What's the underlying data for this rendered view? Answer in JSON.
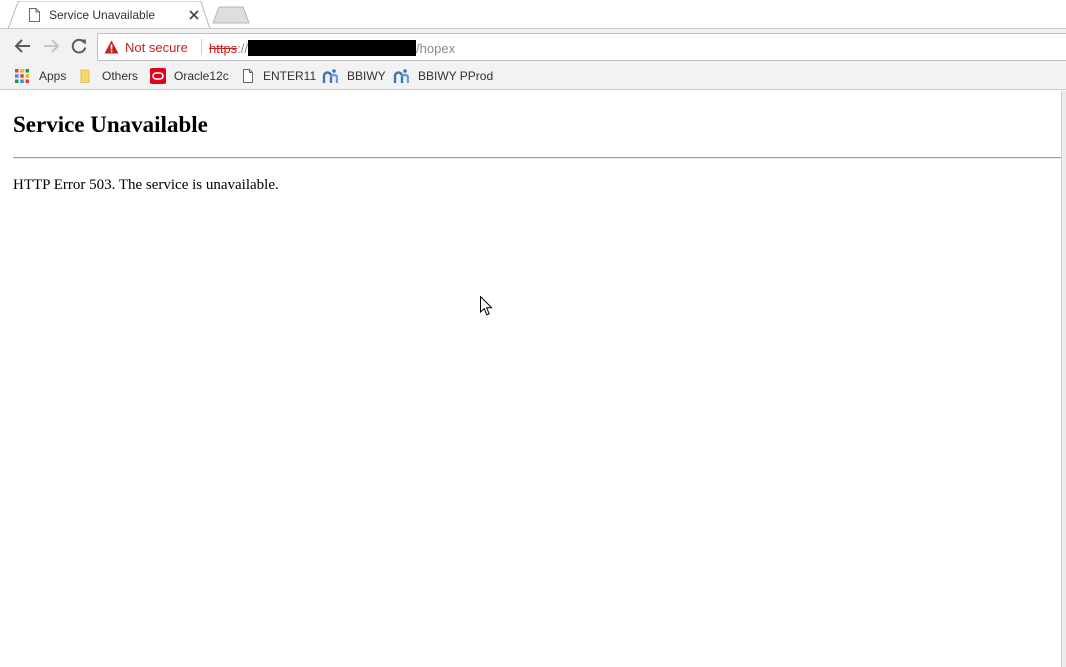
{
  "tab": {
    "title": "Service Unavailable",
    "favicon": "page-icon",
    "close": "close-icon"
  },
  "toolbar": {
    "back": "back-arrow-icon",
    "forward": "forward-arrow-icon",
    "reload": "reload-icon",
    "security_label": "Not secure",
    "security_icon": "warning-triangle-icon",
    "url_scheme": "https",
    "url_separator": "://",
    "url_path": "/hopex"
  },
  "bookmarks": [
    {
      "label": "Apps",
      "icon": "apps-grid-icon"
    },
    {
      "label": "Others",
      "icon": "folder-icon"
    },
    {
      "label": "Oracle12c",
      "icon": "oracle-icon"
    },
    {
      "label": "ENTER11",
      "icon": "page-icon"
    },
    {
      "label": "BBIWY",
      "icon": "app-logo-icon"
    },
    {
      "label": "BBIWY PProd",
      "icon": "app-logo-icon"
    }
  ],
  "page": {
    "heading": "Service Unavailable",
    "message": "HTTP Error 503. The service is unavailable."
  },
  "colors": {
    "warning": "#c5221f",
    "oracle": "#e2001a",
    "folder": "#f9d866",
    "chrome_bg": "#f2f2f2"
  }
}
